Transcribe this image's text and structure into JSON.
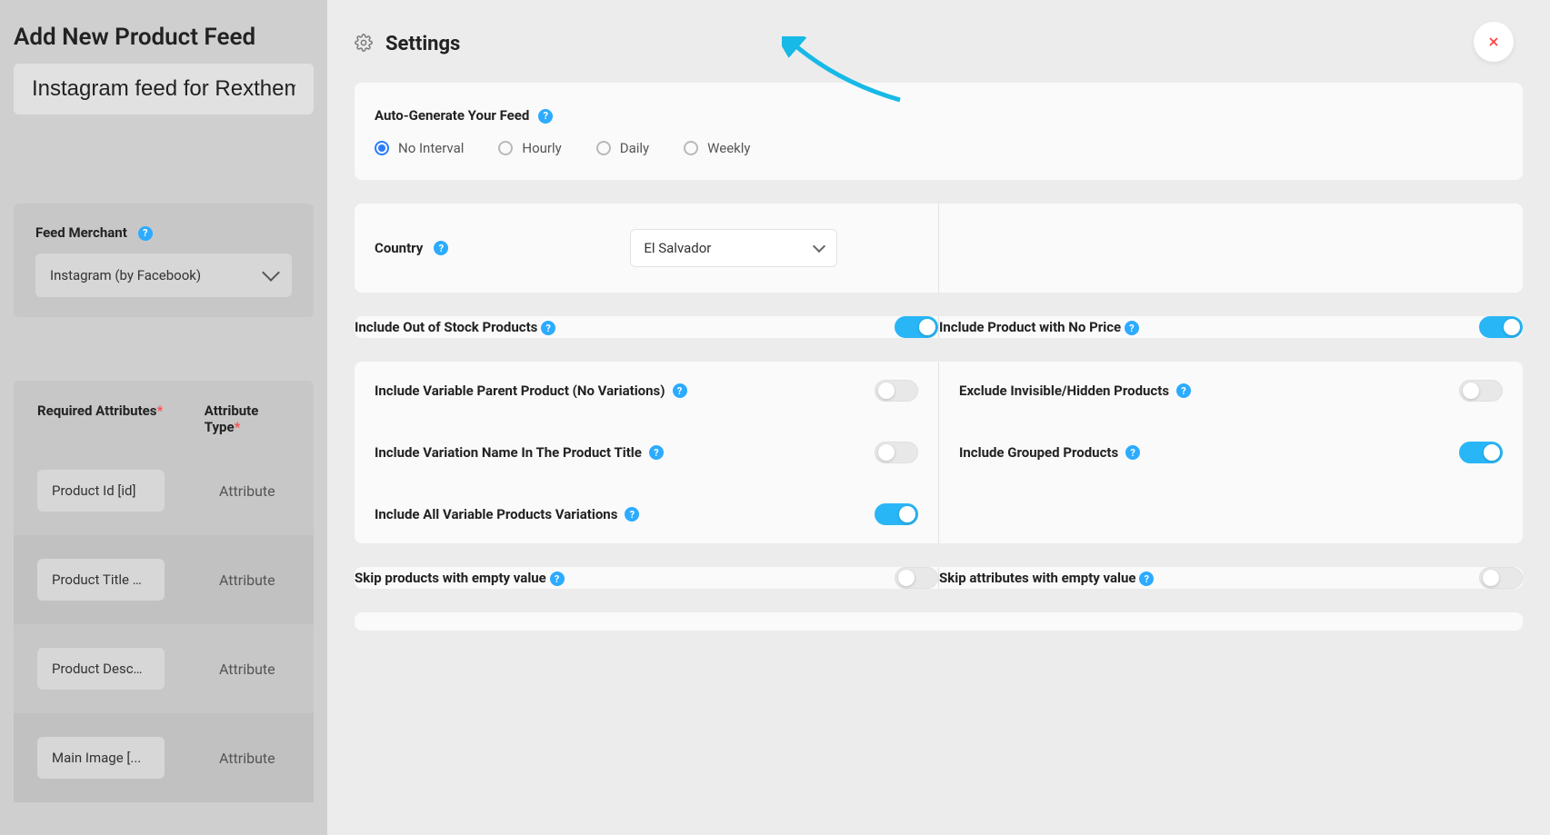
{
  "page": {
    "title": "Add New Product Feed",
    "feed_title_value": "Instagram feed for Rextheme"
  },
  "left": {
    "merchant_label": "Feed Merchant",
    "merchant_value": "Instagram (by Facebook)",
    "attrs": {
      "col1": "Required Attributes",
      "col2": "Attribute Type",
      "rows": [
        {
          "name": "Product Id [id]",
          "type": "Attribute"
        },
        {
          "name": "Product Title …",
          "type": "Attribute"
        },
        {
          "name": "Product Desc…",
          "type": "Attribute"
        },
        {
          "name": "Main Image [...",
          "type": "Attribute"
        }
      ]
    }
  },
  "panel": {
    "title": "Settings",
    "autogen_label": "Auto-Generate Your Feed",
    "options": [
      "No Interval",
      "Hourly",
      "Daily",
      "Weekly"
    ],
    "selected": "No Interval",
    "country_label": "Country",
    "country_value": "El Salvador",
    "toggles": {
      "out_of_stock": {
        "label": "Include Out of Stock Products",
        "on": true
      },
      "no_price": {
        "label": "Include Product with No Price",
        "on": true
      },
      "var_parent": {
        "label": "Include Variable Parent Product (No Variations)",
        "on": false
      },
      "exclude_hidden": {
        "label": "Exclude Invisible/Hidden Products",
        "on": false
      },
      "var_name_title": {
        "label": "Include Variation Name In The Product Title",
        "on": false
      },
      "grouped": {
        "label": "Include Grouped Products",
        "on": true
      },
      "all_var": {
        "label": "Include All Variable Products Variations",
        "on": true
      },
      "skip_prod_empty": {
        "label": "Skip products with empty value",
        "on": false
      },
      "skip_attr_empty": {
        "label": "Skip attributes with empty value",
        "on": false
      }
    }
  }
}
